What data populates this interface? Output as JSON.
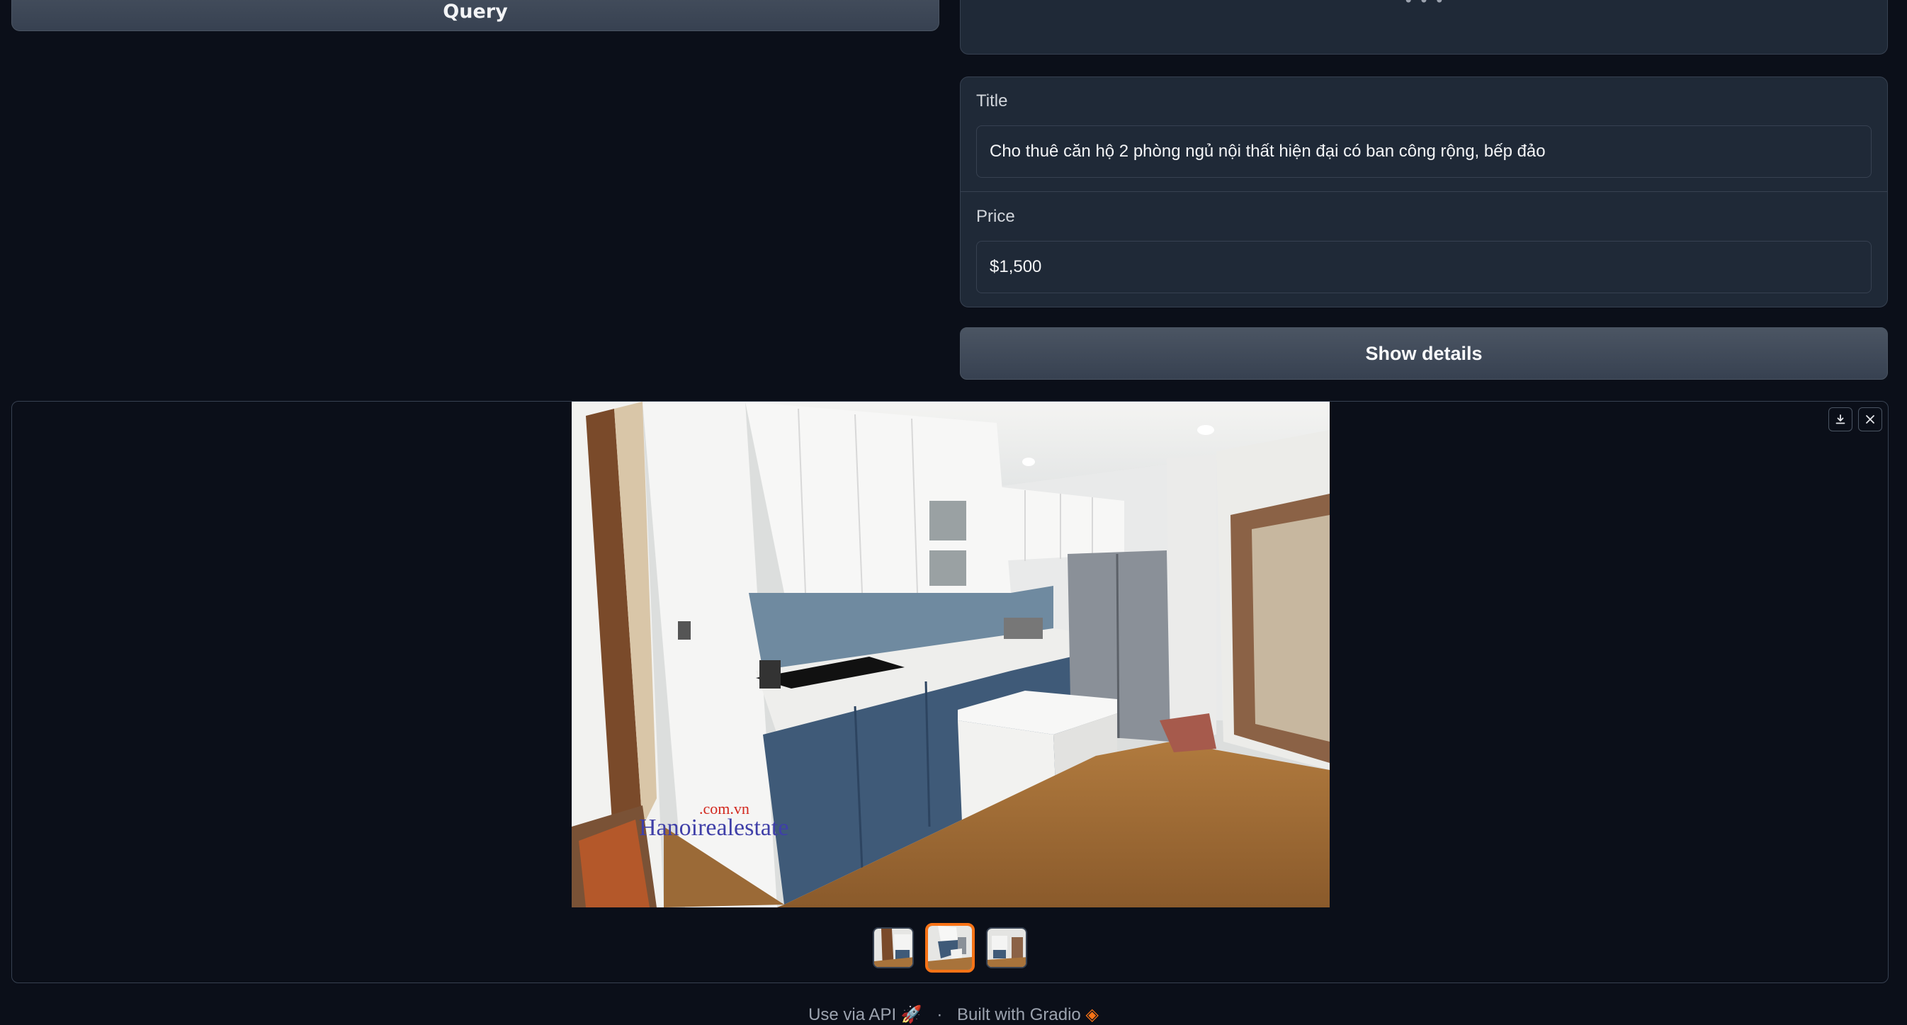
{
  "query_button": {
    "label": "Query"
  },
  "top_panel": {
    "loading": "• • •"
  },
  "fields": {
    "title": {
      "label": "Title",
      "value": "Cho thuê căn hộ 2 phòng ngủ nội thất hiện đại có ban công rộng, bếp đảo"
    },
    "price": {
      "label": "Price",
      "value": "$1,500"
    }
  },
  "show_details_button": {
    "label": "Show details"
  },
  "gallery": {
    "image_count": 3,
    "selected_index": 1,
    "watermark": ".com.vn Hanoirealestate",
    "download_icon": "download-icon",
    "close_icon": "close-icon"
  },
  "footer": {
    "api_link": "Use via API",
    "separator": "·",
    "built_with": "Built with Gradio"
  },
  "colors": {
    "background": "#0b0f19",
    "panel": "#1f2937",
    "border": "#374151",
    "accent_selected": "#f97316"
  }
}
